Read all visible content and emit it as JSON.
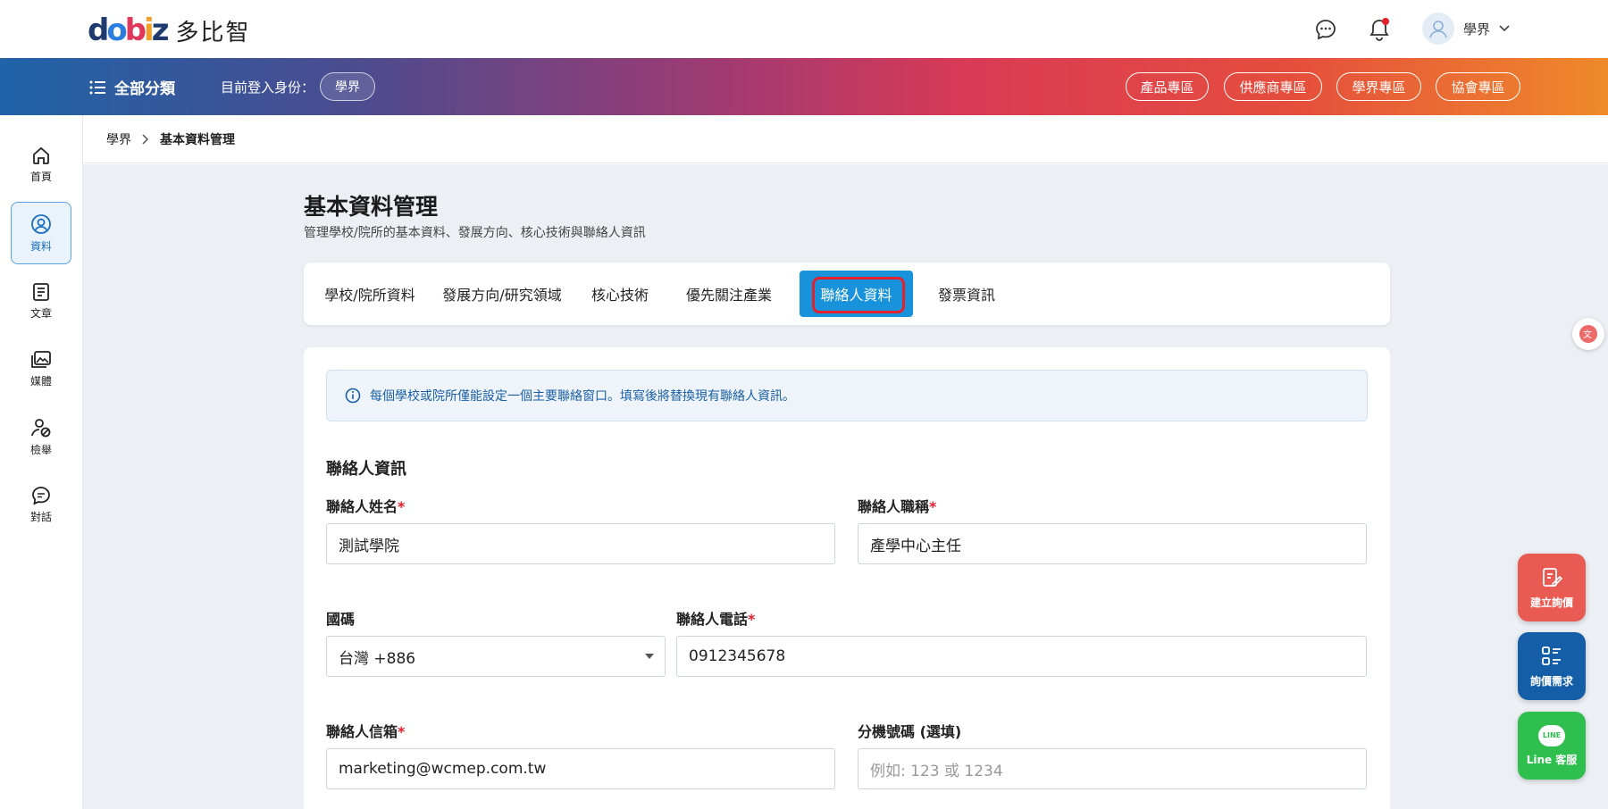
{
  "header": {
    "logo_mark": "dobiz",
    "logo_text": "多比智",
    "user_name": "學界"
  },
  "band": {
    "category_label": "全部分類",
    "login_label": "目前登入身份：",
    "role": "學界",
    "zones": [
      "產品專區",
      "供應商專區",
      "學界專區",
      "協會專區"
    ]
  },
  "rail": {
    "items": [
      {
        "label": "首頁",
        "icon": "home-icon"
      },
      {
        "label": "資料",
        "icon": "user-circle-icon"
      },
      {
        "label": "文章",
        "icon": "document-icon"
      },
      {
        "label": "媒體",
        "icon": "media-icon"
      },
      {
        "label": "檢舉",
        "icon": "report-user-icon"
      },
      {
        "label": "對話",
        "icon": "chat-icon"
      }
    ]
  },
  "breadcrumb": {
    "parent": "學界",
    "current": "基本資料管理"
  },
  "page": {
    "title": "基本資料管理",
    "subtitle": "管理學校/院所的基本資料、發展方向、核心技術與聯絡人資訊"
  },
  "tabs": [
    {
      "label": "學校/院所資料",
      "active": false
    },
    {
      "label": "發展方向/研究領域",
      "active": false
    },
    {
      "label": "核心技術",
      "active": false
    },
    {
      "label": "優先關注產業",
      "active": false
    },
    {
      "label": "聯絡人資料",
      "active": true
    },
    {
      "label": "發票資訊",
      "active": false
    }
  ],
  "form": {
    "notice": "每個學校或院所僅能設定一個主要聯絡窗口。填寫後將替換現有聯絡人資訊。",
    "section_title": "聯絡人資訊",
    "contact_name_label": "聯絡人姓名",
    "contact_name_value": "測試學院",
    "contact_title_label": "聯絡人職稱",
    "contact_title_value": "產學中心主任",
    "country_code_label": "國碼",
    "country_code_value": "台灣 +886",
    "phone_label": "聯絡人電話",
    "phone_value": "0912345678",
    "email_label": "聯絡人信箱",
    "email_value": "marketing@wcmep.com.tw",
    "extension_label": "分機號碼 (選填)",
    "extension_placeholder": "例如: 123 或 1234",
    "required_mark": "*"
  },
  "floating": {
    "create_quote": "建立詢價",
    "quote_requests": "詢價需求",
    "line_service": "Line 客服",
    "line_badge": "LINE"
  },
  "colors": {
    "accent": "#1992dc",
    "required": "#e5202d",
    "quote_red": "#e85a52",
    "quote_blue": "#135ea6",
    "line_green": "#2fbf4e"
  }
}
